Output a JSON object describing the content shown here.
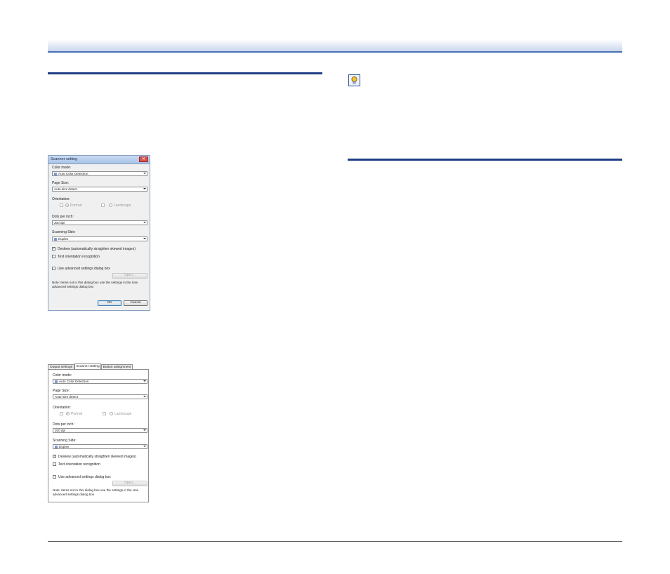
{
  "dialog1": {
    "title": "Scanner setting",
    "close_glyph": "✕",
    "color_mode_label": "Color mode:",
    "color_mode_value": "Auto Color Detection",
    "page_size_label": "Page Size:",
    "page_size_value": "Auto-size detect",
    "orientation_label": "Orientation:",
    "portrait_label": "Portrait",
    "landscape_label": "Landscape",
    "dpi_label": "Dots per inch:",
    "dpi_value": "300 dpi",
    "scanning_side_label": "Scanning Side:",
    "scanning_side_value": "Duplex",
    "deskew_label": "Deskew (automatically straighten skewed images)",
    "deskew_checked": true,
    "text_orientation_label": "Text orientation recognition",
    "text_orientation_checked": false,
    "advanced_label": "Use advanced settings dialog box",
    "advanced_checked": false,
    "open_button": "Open...",
    "note": "Note: Items not in this dialog box use the settings in the Use advanced settings dialog box",
    "ok_button": "OK",
    "cancel_button": "Cancel",
    "check_glyph": "✓"
  },
  "dialog2": {
    "tabs": [
      "Output settings",
      "Scanner setting",
      "Button assignment"
    ],
    "active_tab": "Scanner setting",
    "color_mode_label": "Color mode:",
    "color_mode_value": "Auto Color Detection",
    "page_size_label": "Page Size:",
    "page_size_value": "Auto-size detect",
    "orientation_label": "Orientation:",
    "portrait_label": "Portrait",
    "landscape_label": "Landscape",
    "dpi_label": "Dots per inch:",
    "dpi_value": "200 dpi",
    "scanning_side_label": "Scanning Side:",
    "scanning_side_value": "Duplex",
    "deskew_label": "Deskew (automatically straighten skewed images)",
    "deskew_checked": true,
    "text_orientation_label": "Text orientation recognition",
    "text_orientation_checked": false,
    "advanced_label": "Use advanced settings dialog box",
    "advanced_checked": false,
    "open_button": "Open...",
    "note": "Note: Items not in this dialog box use the settings in the Use advanced settings dialog box",
    "check_glyph": "✓"
  },
  "colors": {
    "rule_blue": "#1f3f86",
    "header_line": "#4a6fb5",
    "hint_icon_bulb": "#f2c232"
  },
  "icons": {
    "hint": "lightbulb-hint-icon"
  }
}
